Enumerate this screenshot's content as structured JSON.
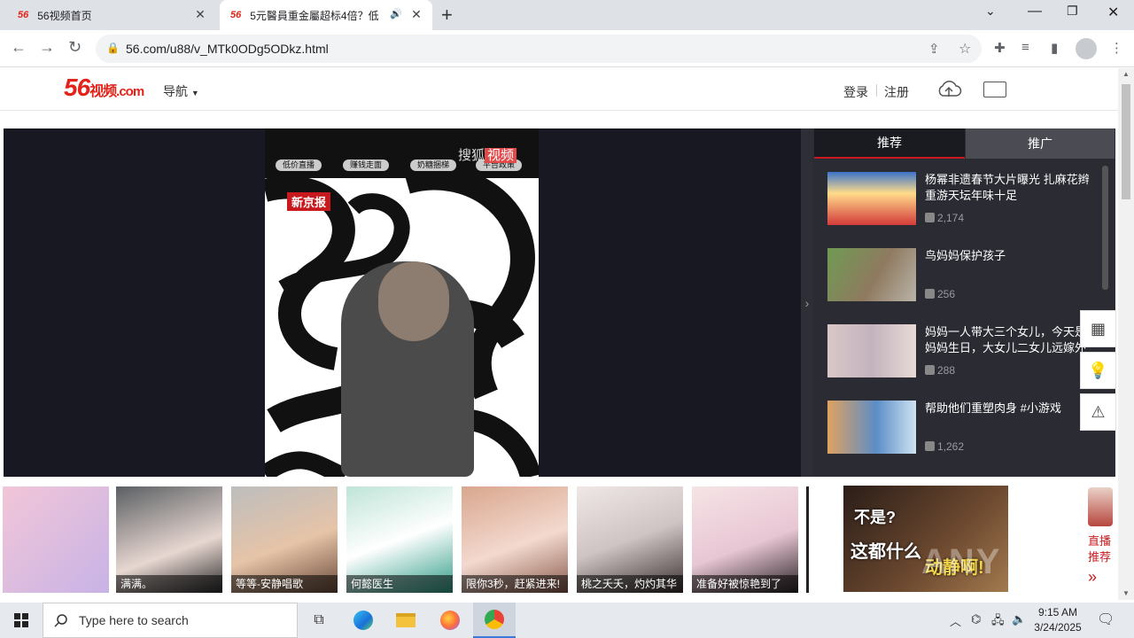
{
  "browser": {
    "tabs": [
      {
        "favicon": "56",
        "title": "56视频首页"
      },
      {
        "favicon": "56",
        "title": "5元醫員重金屬超标4倍？低"
      }
    ],
    "url": "56.com/u88/v_MTk0ODg5ODkz.html"
  },
  "site": {
    "logo_num": "56",
    "logo_text": "视频",
    "logo_domain": ".com",
    "nav_label": "导航",
    "login": "登录",
    "register": "注册"
  },
  "video": {
    "pills": [
      "低价直播",
      "赚钱走面",
      "奶糖捆梯",
      "平台政策"
    ],
    "watermark_a": "搜狐",
    "watermark_b": "视频",
    "badge": "新京报"
  },
  "sidebar": {
    "tabs": [
      "推荐",
      "推广"
    ],
    "items": [
      {
        "title": "杨幂非遗春节大片曝光 扎麻花辫重游天坛年味十足",
        "count": "2,174"
      },
      {
        "title": "鸟妈妈保护孩子",
        "count": "256"
      },
      {
        "title": "妈妈一人带大三个女儿，今天是妈妈生日，大女儿二女儿远嫁外地,",
        "count": "288"
      },
      {
        "title": "帮助他们重塑肉身 #小游戏",
        "count": "1,262"
      }
    ]
  },
  "ads": [
    {
      "caption": ""
    },
    {
      "caption": "满满。"
    },
    {
      "caption": "等等-安静唱歌"
    },
    {
      "caption": "何懿医生"
    },
    {
      "caption": "限你3秒，赶紧进来!"
    },
    {
      "caption": "桃之夭夭，灼灼其华"
    },
    {
      "caption": "准备好被惊艳到了"
    }
  ],
  "big_ad": {
    "line1": "不是?",
    "line2": "这都什么",
    "line3": "动静啊!"
  },
  "live": {
    "label": "直播推荐",
    "arrow": "»"
  },
  "watermark": "ANY RUN",
  "taskbar": {
    "search_placeholder": "Type here to search",
    "time": "9:15 AM",
    "date": "3/24/2025"
  }
}
